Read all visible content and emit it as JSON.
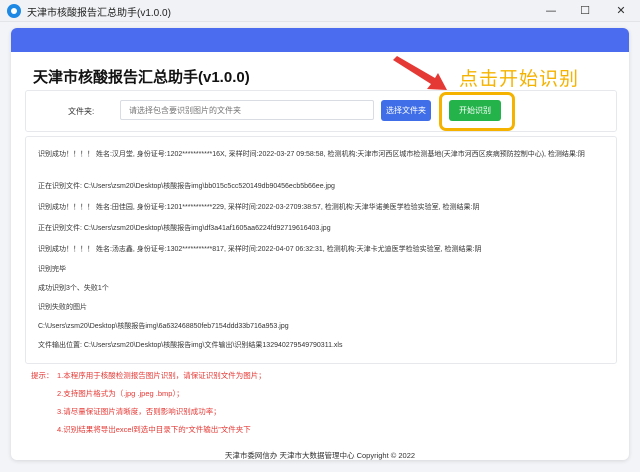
{
  "window": {
    "title": "天津市核酸报告汇总助手(v1.0.0)",
    "minimize_glyph": "—",
    "maximize_glyph": "☐",
    "close_glyph": "✕"
  },
  "app": {
    "heading": "天津市核酸报告汇总助手(v1.0.0)",
    "hint": "点击开始识别"
  },
  "file_row": {
    "label": "文件夹:",
    "placeholder": "请选择包含要识别图片的文件夹",
    "select_button": "选择文件夹",
    "start_button": "开始识别"
  },
  "log": [
    "识别成功！！！！ 姓名:汉月堂, 身份证号:1202***********16X, 采样时间:2022-03-27 09:58:58, 检测机构:天津市河西区城市检测基地(天津市河西区疾病预防控制中心), 检测结果:阴",
    "正在识别文件:  C:\\Users\\zsm20\\Desktop\\核酸报告img\\bb015c5cc520149db90456ecb5b66ee.jpg",
    "识别成功！！！！ 姓名:田佳园, 身份证号:1201***********229, 采样时间:2022-03-2709:38:57, 检测机构:天津华诺美医学检验实验室, 检测结果:阴",
    "正在识别文件:  C:\\Users\\zsm20\\Desktop\\核酸报告img\\df3a41af1605aa6224fd92719616403.jpg",
    "识别成功！！！！ 姓名:汤志鑫, 身份证号:1302***********817, 采样时间:2022-04-07 06:32:31, 检测机构:天津卡尤迪医学检验实验室, 检测结果:阴",
    "识别完毕",
    "成功识别3个、失败1个",
    "识别失败的图片",
    "C:\\Users\\zsm20\\Desktop\\核酸报告img\\6a632468850feb7154ddd33b716a953.jpg",
    "文件输出位置:  C:\\Users\\zsm20\\Desktop\\核酸报告img\\文件输出\\识别结果132940279549790311.xls"
  ],
  "tips": {
    "label": "提示：",
    "items": [
      "1.本程序用于核酸检测报告图片识别，请保证识别文件为图片；",
      "2.支持图片格式为（.jpg .jpeg .bmp）；",
      "3.请尽量保证图片清晰度，否则影响识别成功率；",
      "4.识别结果将导出excel到选中目录下的“文件输出”文件夹下"
    ]
  },
  "footer": "天津市委网信办   天津市大数据管理中心   Copyright   ©   2022",
  "colors": {
    "accent": "#4c6cf0",
    "select_button": "#3f6ee8",
    "start_button": "#23b34a",
    "hint": "#f5b300",
    "arrow": "#e53935",
    "tips": "#e53935"
  }
}
